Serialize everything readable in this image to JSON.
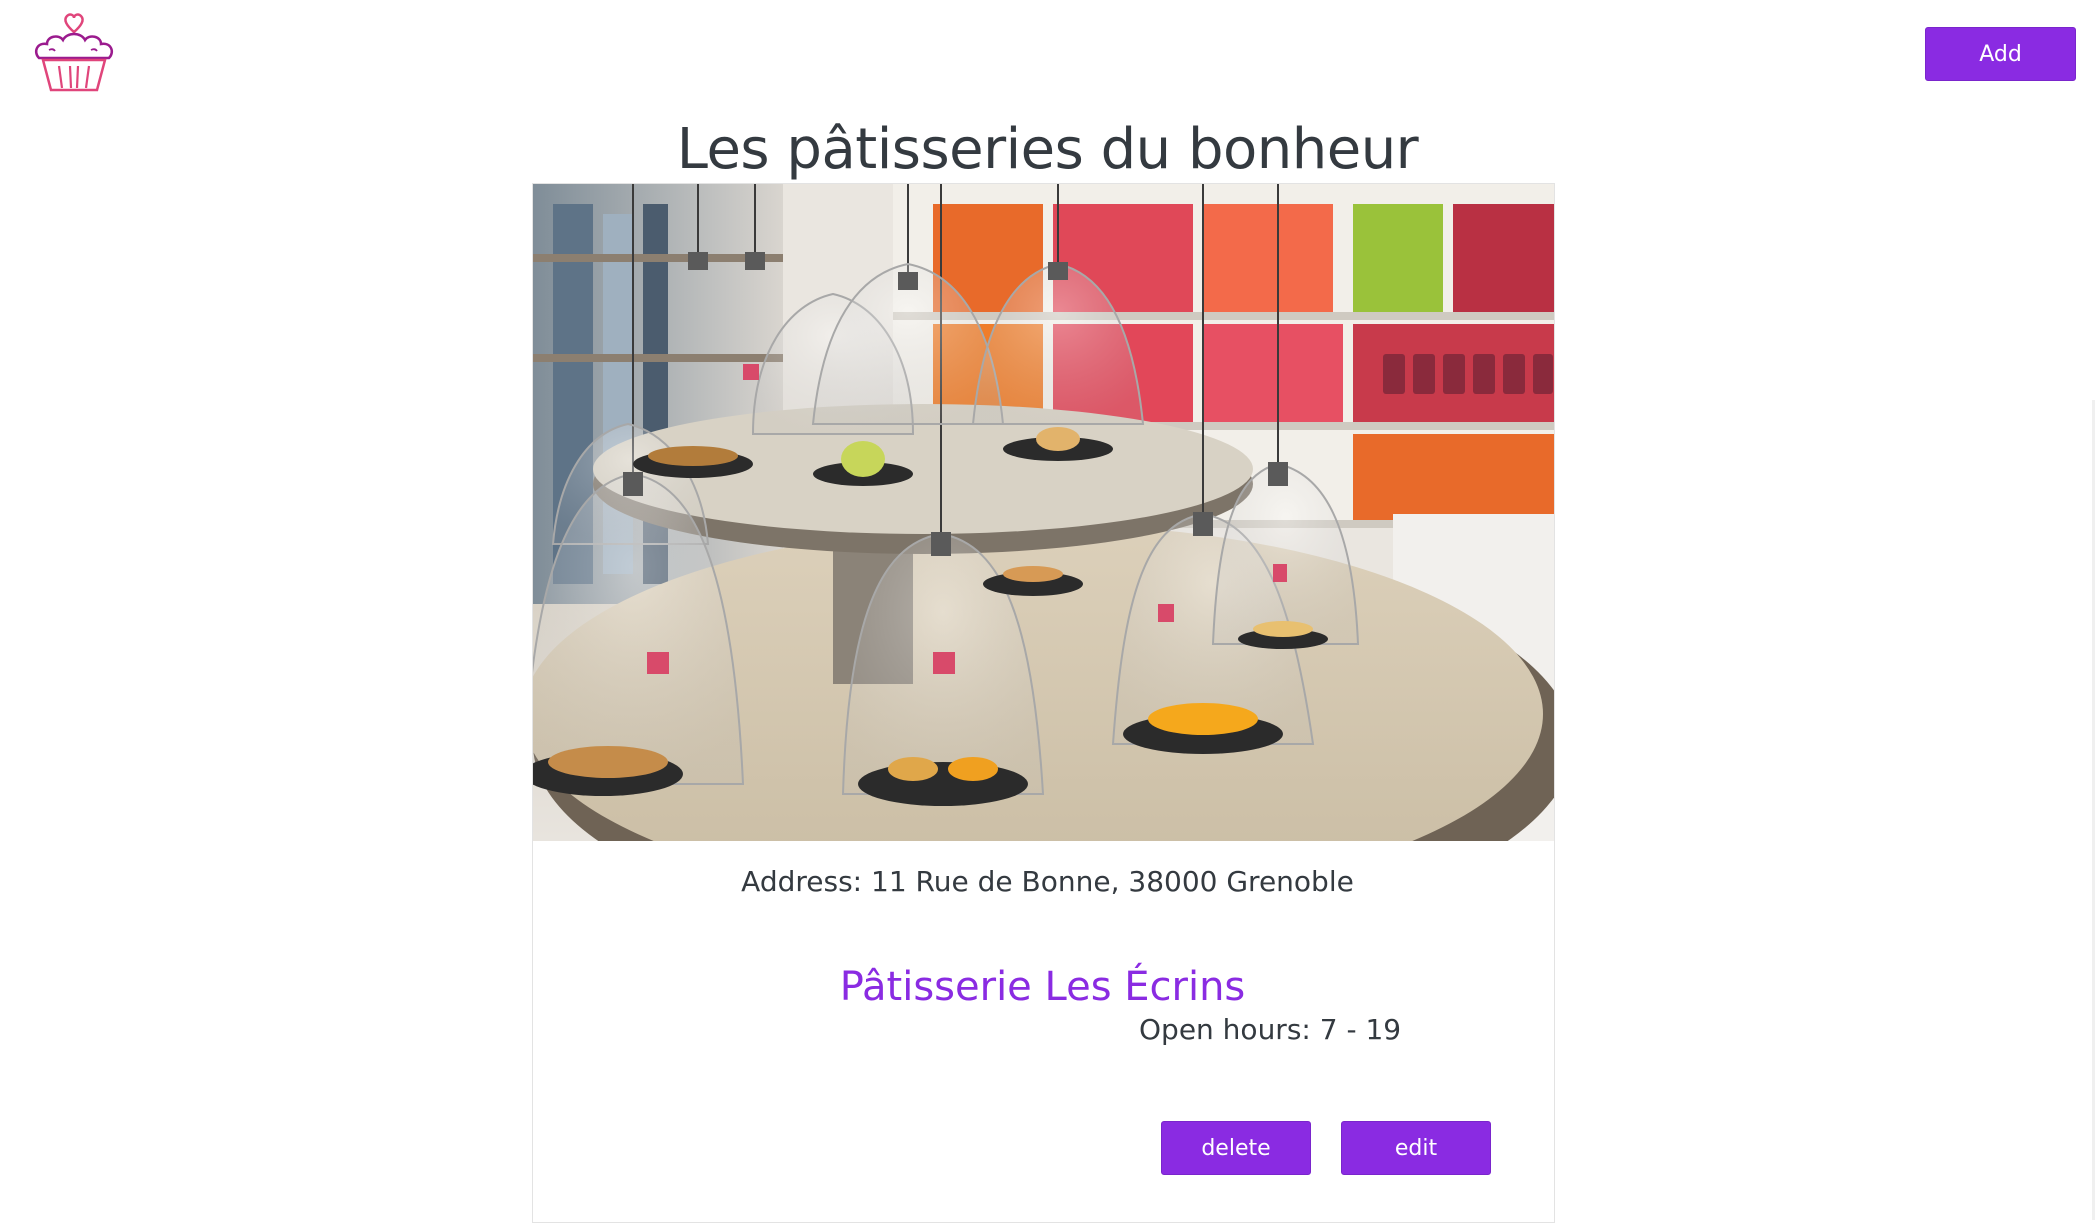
{
  "header": {
    "logo_icon": "cupcake-heart-icon",
    "add_label": "Add"
  },
  "page": {
    "title": "Les pâtisseries du bonheur"
  },
  "card": {
    "image_description_icon": "pastry-shop-photo",
    "address": "Address: 11 Rue de Bonne, 38000 Grenoble",
    "name": "Pâtisserie Les Écrins",
    "open_hours": "Open hours: 7 - 19",
    "delete_label": "delete",
    "edit_label": "edit"
  },
  "colors": {
    "accent": "#8a2be2",
    "text": "#343a40",
    "logo_primary": "#9b1b8e",
    "logo_secondary": "#e0457b"
  }
}
